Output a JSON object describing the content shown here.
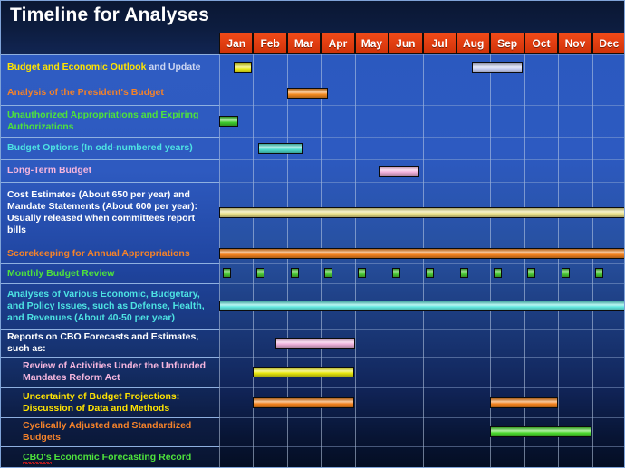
{
  "header": {
    "title": "Timeline for Analyses"
  },
  "months": [
    {
      "label": "Jan"
    },
    {
      "label": "Feb"
    },
    {
      "label": "Mar"
    },
    {
      "label": "Apr"
    },
    {
      "label": "May"
    },
    {
      "label": "Jun"
    },
    {
      "label": "Jul"
    },
    {
      "label": "Aug"
    },
    {
      "label": "Sep"
    },
    {
      "label": "Oct"
    },
    {
      "label": "Nov"
    },
    {
      "label": "Dec"
    }
  ],
  "rows": [
    {
      "id": "budget-and-economic-outlook",
      "label_main": "Budget and Economic Outlook",
      "label_suffix": " and Update",
      "color": "#ffe400"
    },
    {
      "id": "analysis-of-the-presidents-budget",
      "label": "Analysis of the President's Budget",
      "color": "#f4822a"
    },
    {
      "id": "unauthorized-appropriations",
      "label": "Unauthorized Appropriations and Expiring\nAuthorizations",
      "color": "#4ee23c"
    },
    {
      "id": "budget-options",
      "label": "Budget Options (In odd-numbered years)",
      "color": "#4de3e3"
    },
    {
      "id": "long-term-budget",
      "label": "Long-Term Budget",
      "color": "#f5b6de"
    },
    {
      "id": "cost-estimates",
      "label": "Cost Estimates (About 650 per year) and\nMandate Statements (About 600 per year):\nUsually released when committees report\nbills",
      "color": "#ffffff"
    },
    {
      "id": "scorekeeping",
      "label": "Scorekeeping for Annual Appropriations",
      "color": "#f4822a"
    },
    {
      "id": "monthly-budget-review",
      "label": "Monthly Budget Review",
      "color": "#4ee23c"
    },
    {
      "id": "analyses-of-various-issues",
      "label": "Analyses of Various Economic, Budgetary,\nand Policy Issues, such as Defense, Health,\nand Revenues (About 40-50 per year)",
      "color": "#4de3e3"
    },
    {
      "id": "reports-on-cbo-forecasts",
      "label": "Reports on CBO Forecasts and Estimates,\nsuch as:",
      "color": "#ffffff"
    },
    {
      "id": "review-of-activities-umra",
      "label": "Review of Activities Under the Unfunded\nMandates Reform Act",
      "color": "#f5b6de"
    },
    {
      "id": "uncertainty-of-budget-projections",
      "label": "Uncertainty of Budget Projections:\nDiscussion of Data and Methods",
      "color": "#ffe400"
    },
    {
      "id": "cyclically-adjusted-budgets",
      "label": "Cyclically Adjusted and Standardized\nBudgets",
      "color": "#f4822a"
    },
    {
      "id": "cbo-economic-forecasting-record",
      "label_err": "CBO's",
      "label_rest": " Economic Forecasting Record",
      "color": "#4ee23c"
    }
  ],
  "chart_data": {
    "type": "bar",
    "title": "Timeline for Analyses",
    "xlabel": "",
    "ylabel": "",
    "categories": [
      "Jan",
      "Feb",
      "Mar",
      "Apr",
      "May",
      "Jun",
      "Jul",
      "Aug",
      "Sep",
      "Oct",
      "Nov",
      "Dec"
    ],
    "x_axis_kind": "months-of-year",
    "grid": "vertical-only",
    "legend": "none",
    "series": [
      {
        "name": "Budget and Economic Outlook and Update",
        "color": "#e8e81a",
        "intervals": [
          {
            "start_month": 1.42,
            "end_month": 1.95,
            "label": "Jan"
          },
          {
            "start_month": 8.45,
            "end_month": 9.95,
            "label": "mid-Aug to mid-Sep",
            "color": "#c6cdf0"
          }
        ]
      },
      {
        "name": "Analysis of the President's Budget",
        "color": "#f48b20",
        "intervals": [
          {
            "start_month": 3.0,
            "end_month": 4.2,
            "label": "Mar"
          }
        ]
      },
      {
        "name": "Unauthorized Appropriations and Expiring Authorizations",
        "color": "#3ecb2f",
        "intervals": [
          {
            "start_month": 1.0,
            "end_month": 1.55,
            "label": "early Jan"
          }
        ]
      },
      {
        "name": "Budget Options (In odd-numbered years)",
        "color": "#4fdfd0",
        "intervals": [
          {
            "start_month": 2.15,
            "end_month": 3.45,
            "label": "Feb to early Mar"
          }
        ]
      },
      {
        "name": "Long-Term Budget",
        "color": "#f5b3dd",
        "intervals": [
          {
            "start_month": 5.7,
            "end_month": 6.9,
            "label": "late May to Jun"
          }
        ]
      },
      {
        "name": "Cost Estimates and Mandate Statements",
        "color": "#e8e08a",
        "intervals": [
          {
            "start_month": 1.0,
            "end_month": 13.0,
            "label": "all year"
          }
        ]
      },
      {
        "name": "Scorekeeping for Annual Appropriations",
        "color": "#f2821f",
        "intervals": [
          {
            "start_month": 1.0,
            "end_month": 13.0,
            "label": "all year"
          }
        ]
      },
      {
        "name": "Monthly Budget Review",
        "color": "#4bc934",
        "markers_per_month": 1,
        "marker_shape": "square",
        "intervals": [
          {
            "start_month": 1.1,
            "end_month": 1.35
          },
          {
            "start_month": 2.1,
            "end_month": 2.35
          },
          {
            "start_month": 3.1,
            "end_month": 3.35
          },
          {
            "start_month": 4.1,
            "end_month": 4.35
          },
          {
            "start_month": 5.1,
            "end_month": 5.35
          },
          {
            "start_month": 6.1,
            "end_month": 6.35
          },
          {
            "start_month": 7.1,
            "end_month": 7.35
          },
          {
            "start_month": 8.1,
            "end_month": 8.35
          },
          {
            "start_month": 9.1,
            "end_month": 9.35
          },
          {
            "start_month": 10.1,
            "end_month": 10.35
          },
          {
            "start_month": 11.1,
            "end_month": 11.35
          },
          {
            "start_month": 12.1,
            "end_month": 12.35
          }
        ]
      },
      {
        "name": "Analyses of Various Economic, Budgetary, and Policy Issues",
        "color": "#62e8e0",
        "intervals": [
          {
            "start_month": 1.0,
            "end_month": 13.0,
            "label": "all year"
          }
        ]
      },
      {
        "name": "Review of Activities Under the Unfunded Mandates Reform Act",
        "color": "#f0b4de",
        "intervals": [
          {
            "start_month": 2.65,
            "end_month": 5.0,
            "label": "late Feb to Apr"
          }
        ]
      },
      {
        "name": "Uncertainty of Budget Projections: Discussion of Data and Methods",
        "color": "#e8e80f",
        "intervals": [
          {
            "start_month": 2.0,
            "end_month": 5.0,
            "label": "Feb to Apr"
          }
        ]
      },
      {
        "name": "Cyclically Adjusted and Standardized Budgets",
        "color": "#f2821f",
        "intervals": [
          {
            "start_month": 2.0,
            "end_month": 5.0,
            "label": "Feb to Apr"
          },
          {
            "start_month": 9.0,
            "end_month": 11.0,
            "label": "Sep to Oct"
          }
        ]
      },
      {
        "name": "CBO's Economic Forecasting Record",
        "color": "#4bd92e",
        "intervals": [
          {
            "start_month": 9.0,
            "end_month": 12.0,
            "label": "Sep to Nov"
          }
        ]
      }
    ]
  }
}
